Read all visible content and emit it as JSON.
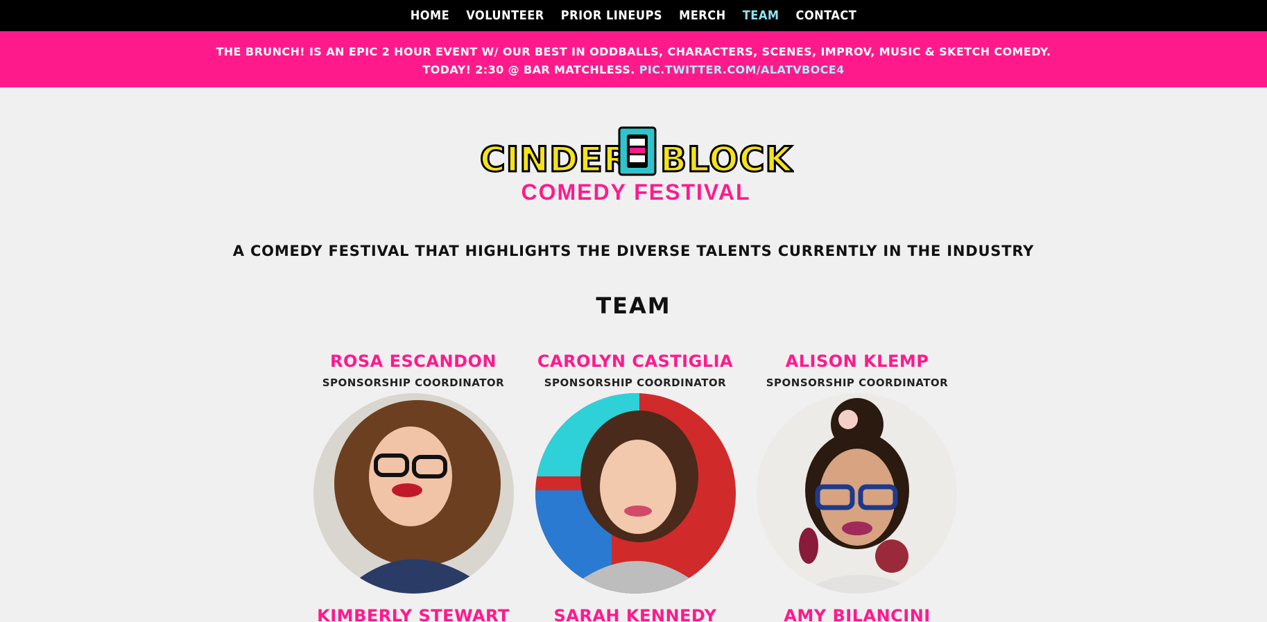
{
  "nav": {
    "items": [
      {
        "label": "HOME",
        "active": false
      },
      {
        "label": "VOLUNTEER",
        "active": false
      },
      {
        "label": "PRIOR LINEUPS",
        "active": false
      },
      {
        "label": "MERCH",
        "active": false
      },
      {
        "label": "TEAM",
        "active": true
      },
      {
        "label": "CONTACT",
        "active": false
      }
    ]
  },
  "banner": {
    "line1": "THE BRUNCH! IS AN EPIC 2 HOUR EVENT W/ OUR BEST IN ODDBALLS, CHARACTERS, SCENES, IMPROV, MUSIC & SKETCH COMEDY.",
    "line2_text": "TODAY! 2:30 @ BAR MATCHLESS.",
    "line2_link": "PIC.TWITTER.COM/ALATVBOCE4"
  },
  "logo": {
    "top_text_left": "CINDER",
    "top_text_right": "BLOCK",
    "bottom_text": "COMEDY FESTIVAL"
  },
  "tagline": "A COMEDY FESTIVAL THAT HIGHLIGHTS THE DIVERSE TALENTS CURRENTLY IN THE INDUSTRY",
  "team_heading": "TEAM",
  "members": [
    {
      "name": "ROSA ESCANDON",
      "role": "SPONSORSHIP COORDINATOR"
    },
    {
      "name": "CAROLYN CASTIGLIA",
      "role": "SPONSORSHIP COORDINATOR"
    },
    {
      "name": "ALISON KLEMP",
      "role": "SPONSORSHIP COORDINATOR"
    },
    {
      "name": "KIMBERLY STEWART",
      "role": ""
    },
    {
      "name": "SARAH KENNEDY",
      "role": ""
    },
    {
      "name": "AMY BILANCINI",
      "role": ""
    }
  ],
  "colors": {
    "nav_bg": "#000000",
    "banner_bg": "#ff1a8c",
    "accent_pink": "#ff1a8c",
    "active_nav": "#8fe3ee",
    "page_bg": "#f0f0f0"
  }
}
